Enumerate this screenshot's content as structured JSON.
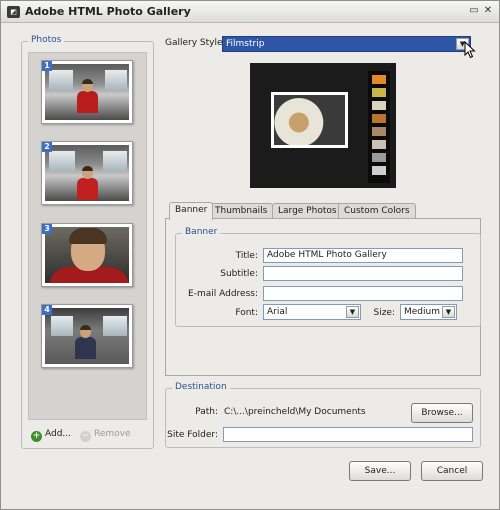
{
  "window": {
    "title": "Adobe HTML Photo Gallery",
    "icon": "photo-gallery-app-icon"
  },
  "photos": {
    "label": "Photos",
    "items": [
      {
        "number": "1"
      },
      {
        "number": "2"
      },
      {
        "number": "3"
      },
      {
        "number": "4"
      }
    ],
    "add_label": "Add...",
    "remove_label": "Remove"
  },
  "gallery": {
    "label": "Gallery Style:",
    "value": "Filmstrip"
  },
  "tabs": [
    "Banner",
    "Thumbnails",
    "Large Photos",
    "Custom Colors"
  ],
  "banner": {
    "group_label": "Banner",
    "title_label": "Title:",
    "title_value": "Adobe HTML Photo Gallery",
    "subtitle_label": "Subtitle:",
    "subtitle_value": "",
    "email_label": "E-mail Address:",
    "email_value": "",
    "font_label": "Font:",
    "font_value": "Arial",
    "size_label": "Size:",
    "size_value": "Medium"
  },
  "destination": {
    "group_label": "Destination",
    "path_label": "Path:",
    "path_value": "C:\\...\\preincheld\\My Documents",
    "browse_label": "Browse...",
    "site_folder_label": "Site Folder:",
    "site_folder_value": ""
  },
  "buttons": {
    "save_label": "Save...",
    "cancel_label": "Cancel"
  }
}
